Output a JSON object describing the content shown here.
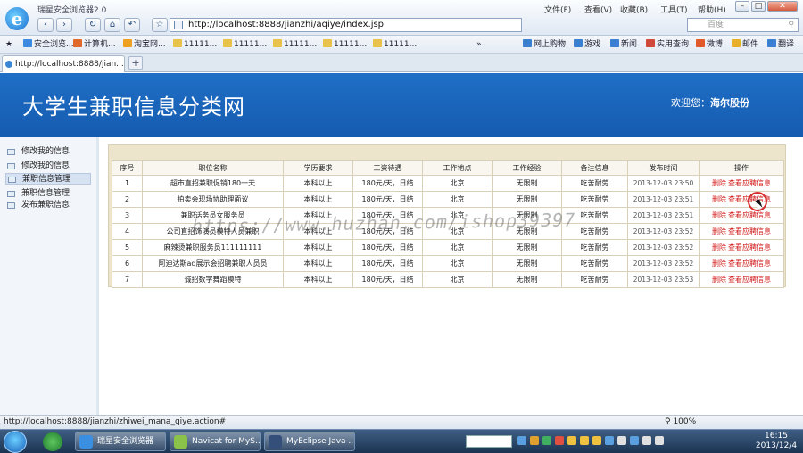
{
  "browser": {
    "app_title": "瑞星安全浏览器2.0",
    "address": "http://localhost:8888/jianzhi/aqiye/index.jsp",
    "search_placeholder": "百度",
    "menus": [
      "文件(F)",
      "查看(V)",
      "收藏(B)",
      "工具(T)",
      "帮助(H)"
    ],
    "favorites": [
      "安全浏览...",
      "计算机...",
      "淘宝网...",
      "11111...",
      "11111...",
      "11111...",
      "11111...",
      "11111...",
      "网上购物",
      "游戏",
      "新闻",
      "实用查询",
      "微博",
      "邮件",
      "翻译"
    ],
    "tab_title": "http://localhost:8888/jian...",
    "new_tab": "+",
    "status_url": "http://localhost:8888/jianzhi/zhiwei_mana_qiye.action#",
    "zoom": "100%"
  },
  "header": {
    "site_title": "大学生兼职信息分类网",
    "welcome_label": "欢迎您：",
    "user_name": "海尔股份"
  },
  "sidebar": {
    "items": [
      {
        "label": "修改我的信息",
        "group": false
      },
      {
        "label": "修改我的信息",
        "group": false
      },
      {
        "label": "兼职信息管理",
        "group": true
      },
      {
        "label": "兼职信息管理",
        "group": false
      },
      {
        "label": "发布兼职信息",
        "group": false
      }
    ]
  },
  "table": {
    "headers": [
      "序号",
      "职位名称",
      "学历要求",
      "工资待遇",
      "工作地点",
      "工作经验",
      "备注信息",
      "发布时间",
      "操作"
    ],
    "rows": [
      {
        "no": "1",
        "title": "超市直招兼职促销180一天",
        "edu": "本科以上",
        "salary": "180元/天，日结",
        "place": "北京",
        "exp": "无限制",
        "note": "吃苦耐劳",
        "time": "2013-12-03 23:50"
      },
      {
        "no": "2",
        "title": "拍卖会现场协助理面议",
        "edu": "本科以上",
        "salary": "180元/天，日结",
        "place": "北京",
        "exp": "无限制",
        "note": "吃苦耐劳",
        "time": "2013-12-03 23:51"
      },
      {
        "no": "3",
        "title": "兼职话务员女服务员",
        "edu": "本科以上",
        "salary": "180元/天，日结",
        "place": "北京",
        "exp": "无限制",
        "note": "吃苦耐劳",
        "time": "2013-12-03 23:51"
      },
      {
        "no": "4",
        "title": "公司直招饰演员模特人员兼职",
        "edu": "本科以上",
        "salary": "180元/天，日结",
        "place": "北京",
        "exp": "无限制",
        "note": "吃苦耐劳",
        "time": "2013-12-03 23:52"
      },
      {
        "no": "5",
        "title": "麻辣烫兼职服务员111111111",
        "edu": "本科以上",
        "salary": "180元/天，日结",
        "place": "北京",
        "exp": "无限制",
        "note": "吃苦耐劳",
        "time": "2013-12-03 23:52"
      },
      {
        "no": "6",
        "title": "阿迪达斯ad展示会招聘兼职人员员",
        "edu": "本科以上",
        "salary": "180元/天，日结",
        "place": "北京",
        "exp": "无限制",
        "note": "吃苦耐劳",
        "time": "2013-12-03 23:52"
      },
      {
        "no": "7",
        "title": "诚招数字舞蹈模特",
        "edu": "本科以上",
        "salary": "180元/天，日结",
        "place": "北京",
        "exp": "无限制",
        "note": "吃苦耐劳",
        "time": "2013-12-03 23:53"
      }
    ],
    "op_delete": "删除",
    "op_view": "查看应聘信息"
  },
  "watermark": "https://www.huzhan.com/ishop39397",
  "taskbar": {
    "apps": [
      "瑞星安全浏览器",
      "Navicat for MyS...",
      "MyEclipse Java ..."
    ],
    "time": "16:15",
    "date": "2013/12/4"
  },
  "colors": {
    "banner": "#1f6fc6",
    "panel": "#ede4cc",
    "op_link": "#d01818"
  }
}
